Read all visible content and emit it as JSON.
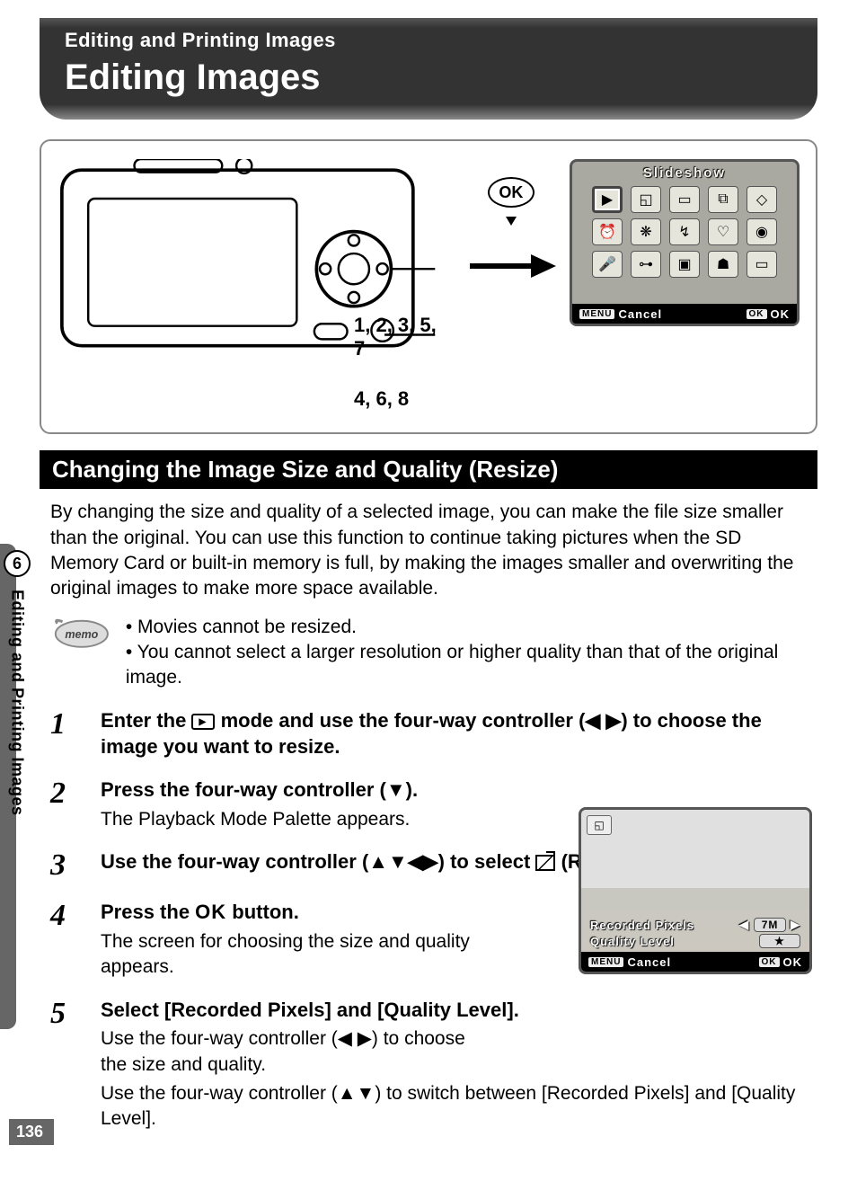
{
  "chapter": {
    "small_title": "Editing and Printing Images",
    "big_title": "Editing Images"
  },
  "diagram": {
    "callout1": "1, 2, 3, 5, 7",
    "callout2": "4, 6, 8",
    "ok_label": "OK",
    "lcd_title": "Slideshow",
    "footer": {
      "menu_badge": "MENU",
      "cancel": "Cancel",
      "ok_badge": "OK",
      "ok": "OK"
    }
  },
  "section_title": "Changing the Image Size and Quality (Resize)",
  "intro": "By changing the size and quality of a selected image, you can make the file size smaller than the original. You can use this function to continue taking pictures when the SD Memory Card or built-in memory is full, by making the images smaller and overwriting the original images to make more space available.",
  "memo": {
    "label": "memo",
    "item1": "Movies cannot be resized.",
    "item2": "You cannot select a larger resolution or higher quality than that of the original image."
  },
  "steps": {
    "s1": {
      "num": "1",
      "title_a": "Enter the ",
      "title_b": " mode and use the four-way controller (◀ ▶) to choose the image you want to resize."
    },
    "s2": {
      "num": "2",
      "title": "Press the four-way controller (▼).",
      "desc": "The Playback Mode Palette appears."
    },
    "s3": {
      "num": "3",
      "title_a": "Use the four-way controller (▲▼◀▶) to select ",
      "title_b": " (Resize)."
    },
    "s4": {
      "num": "4",
      "title_a": "Press the ",
      "ok": "OK",
      "title_b": " button.",
      "desc": "The screen for choosing the size and quality appears."
    },
    "s5": {
      "num": "5",
      "title": "Select [Recorded Pixels] and [Quality Level].",
      "desc1": "Use the four-way controller (◀ ▶) to choose the size and quality.",
      "desc2": "Use the four-way controller (▲▼) to switch between [Recorded Pixels] and [Quality Level]."
    }
  },
  "resize_lcd": {
    "row1_label": "Recorded Pixels",
    "row1_val": "7M",
    "row2_label": "Quality Level",
    "row2_val": "★",
    "footer": {
      "menu_badge": "MENU",
      "cancel": "Cancel",
      "ok_badge": "OK",
      "ok": "OK"
    }
  },
  "tab": {
    "num": "6",
    "text": "Editing and Printing Images"
  },
  "page_number": "136"
}
